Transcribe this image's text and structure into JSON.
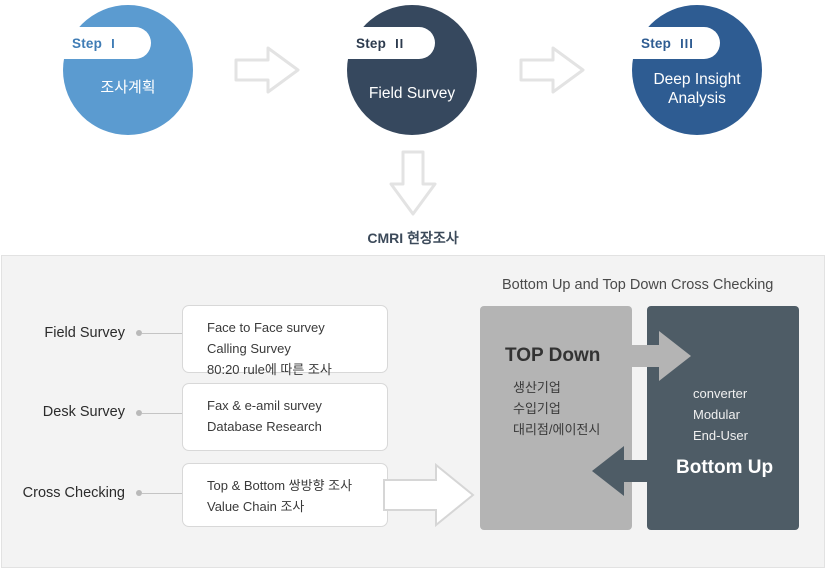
{
  "steps": [
    {
      "badge_label": "Step",
      "roman": "I",
      "title": "조사계획",
      "circle_color": "#5b9bd0",
      "badge_color": "#3f7cb5"
    },
    {
      "badge_label": "Step",
      "roman": "II",
      "title": "Field Survey",
      "circle_color": "#36485e",
      "badge_color": "#2d3b4e"
    },
    {
      "badge_label": "Step",
      "roman": "III",
      "title": "Deep Insight\nAnalysis",
      "title_line1": "Deep Insight",
      "title_line2": "Analysis",
      "circle_color": "#2e5c92",
      "badge_color": "#2e5c92"
    }
  ],
  "flow": {
    "arrow_1": "right-chevron-arrow",
    "arrow_2": "right-chevron-arrow",
    "down_arrow": "down-chevron-arrow",
    "cmri_caption": "CMRI 현장조사"
  },
  "panel": {
    "rows": [
      {
        "label": "Field Survey",
        "items": [
          "Face to Face survey",
          "Calling Survey",
          "80:20 rule에 따른 조사"
        ]
      },
      {
        "label": "Desk Survey",
        "items": [
          "Fax & e-amil survey",
          "Database Research"
        ]
      },
      {
        "label": "Cross Checking",
        "items": [
          "Top & Bottom 쌍방향 조사",
          "Value Chain 조사"
        ]
      }
    ],
    "big_arrow": "right-block-arrow",
    "cross_check": {
      "title": "Bottom Up and Top Down Cross Checking",
      "top_down": {
        "heading": "TOP Down",
        "items": [
          "생산기업",
          "수입기업",
          "대리점/에이전시"
        ],
        "color": "#b4b4b4"
      },
      "bottom_up": {
        "heading": "Bottom Up",
        "items": [
          "converter",
          "Modular",
          "End-User"
        ],
        "color": "#4e5c66"
      },
      "arrow_right": "right-block-arrow",
      "arrow_left": "left-block-arrow"
    }
  }
}
